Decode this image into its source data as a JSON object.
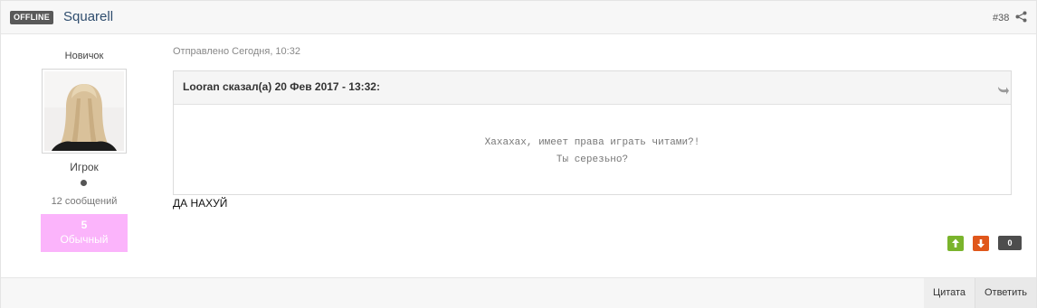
{
  "header": {
    "status_badge": "OFFLINE",
    "author_name": "Squarell",
    "post_number": "#38",
    "share_icon": "share-icon"
  },
  "author": {
    "rank": "Новичок",
    "avatar_icon": "avatar-photo",
    "group": "Игрок",
    "online_indicator_icon": "status-dot-icon",
    "post_count": "12 сообщений",
    "reputation_value": "5",
    "reputation_label": "Обычный",
    "reputation_color": "#fbb4fb"
  },
  "post": {
    "date": "Отправлено Сегодня, 10:32",
    "quote": {
      "citation": "Looran сказал(а) 20 Фев 2017 - 13:32:",
      "jump_icon": "quote-jump-icon",
      "line1": "Хахахах, имеет права играть читами?!",
      "line2": "Ты серезьно?"
    },
    "text": "ДА НАХУЙ"
  },
  "votes": {
    "up_icon": "arrow-up-icon",
    "down_icon": "arrow-down-icon",
    "score": "0",
    "up_color": "#7ab42c",
    "down_color": "#e0571b"
  },
  "footer": {
    "quote_label": "Цитата",
    "reply_label": "Ответить"
  }
}
